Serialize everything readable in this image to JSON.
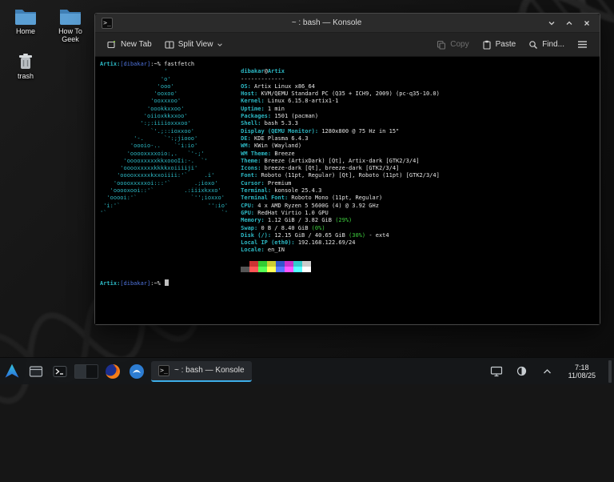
{
  "desktop": {
    "icons": [
      {
        "label": "Home",
        "type": "folder"
      },
      {
        "label": "How To Geek",
        "type": "folder"
      },
      {
        "label": "trash",
        "type": "trash"
      }
    ]
  },
  "window": {
    "title": "~ : bash — Konsole",
    "toolbar": {
      "new_tab": "New Tab",
      "split_view": "Split View",
      "copy": "Copy",
      "paste": "Paste",
      "find": "Find..."
    }
  },
  "terminal": {
    "prompt_command": [
      {
        "t": "Artix:",
        "c": "cyan"
      },
      {
        "t": "[dibakar]",
        "c": "blue"
      },
      {
        "t": ":~%",
        "c": "fg"
      },
      {
        "t": " fastfetch",
        "c": "fg"
      }
    ],
    "prompt": [
      {
        "t": "Artix:",
        "c": "cyan"
      },
      {
        "t": "[dibakar]",
        "c": "blue"
      },
      {
        "t": ":~%",
        "c": "fg"
      },
      {
        "t": " ",
        "c": "fg"
      }
    ],
    "art": [
      "                   '",
      "                  'o'",
      "                 'ooo'",
      "                'ooxoo'",
      "               'ooxxxoo'",
      "              'oookkxxoo'",
      "             'oiioxkkxxoo'",
      "            ':;:iiiioxxxoo'",
      "               `'.;::ioxxoo'",
      "          '-.      `':;jiooo'",
      "         'oooio-..    `'i:io'",
      "        'ooooxxxxoio:,.   `'-;'",
      "       'ooooxxxxxkkxoooIi:-.  `'",
      "      'ooooxxxxxkkkkxoiiiiji'",
      "     'ooooxxxxxkxxoiiii:'`     .i'",
      "    'ooooxxxxxoi:::'`       .;ioxo'",
      "   'ooooxooi::'`         .:iiixkxxo'",
      "  'ooooi:'`                `'';ioxxo'",
      " 'i:'`                          '':io'",
      "'`                                  `'"
    ],
    "info": [
      {
        "segments": [
          {
            "t": "dibakar",
            "c": "cyan"
          },
          {
            "t": "@",
            "c": "fg"
          },
          {
            "t": "Artix",
            "c": "cyan"
          }
        ]
      },
      {
        "segments": [
          {
            "t": "-------------",
            "c": "fg"
          }
        ]
      },
      {
        "label": "OS:",
        "segments": [
          {
            "t": "Artix Linux x86_64"
          }
        ]
      },
      {
        "label": "Host:",
        "segments": [
          {
            "t": "KVM/QEMU Standard PC (Q35 + ICH9, 2009) (pc-q35-10.0)"
          }
        ]
      },
      {
        "label": "Kernel:",
        "segments": [
          {
            "t": "Linux 6.15.8-artix1-1"
          }
        ]
      },
      {
        "label": "Uptime:",
        "segments": [
          {
            "t": "1 min"
          }
        ]
      },
      {
        "label": "Packages:",
        "segments": [
          {
            "t": "1501 (pacman)"
          }
        ]
      },
      {
        "label": "Shell:",
        "segments": [
          {
            "t": "bash 5.3.3"
          }
        ]
      },
      {
        "label": "Display (QEMU Monitor):",
        "segments": [
          {
            "t": "1280x800 @ 75 Hz in 15\""
          }
        ]
      },
      {
        "label": "DE:",
        "segments": [
          {
            "t": "KDE Plasma 6.4.3"
          }
        ]
      },
      {
        "label": "WM:",
        "segments": [
          {
            "t": "KWin (Wayland)"
          }
        ]
      },
      {
        "label": "WM Theme:",
        "segments": [
          {
            "t": "Breeze"
          }
        ]
      },
      {
        "label": "Theme:",
        "segments": [
          {
            "t": "Breeze (ArtixDark) [Qt], Artix-dark [GTK2/3/4]"
          }
        ]
      },
      {
        "label": "Icons:",
        "segments": [
          {
            "t": "breeze-dark [Qt], breeze-dark [GTK2/3/4]"
          }
        ]
      },
      {
        "label": "Font:",
        "segments": [
          {
            "t": "Roboto (11pt, Regular) [Qt], Roboto (11pt) [GTK2/3/4]"
          }
        ]
      },
      {
        "label": "Cursor:",
        "segments": [
          {
            "t": "Premium"
          }
        ]
      },
      {
        "label": "Terminal:",
        "segments": [
          {
            "t": "konsole 25.4.3"
          }
        ]
      },
      {
        "label": "Terminal Font:",
        "segments": [
          {
            "t": "Roboto Mono (11pt, Regular)"
          }
        ]
      },
      {
        "label": "CPU:",
        "segments": [
          {
            "t": "4 x AMD Ryzen 5 5600G (4) @ 3.92 GHz"
          }
        ]
      },
      {
        "label": "GPU:",
        "segments": [
          {
            "t": "RedHat Virtio 1.0 GPU"
          }
        ]
      },
      {
        "label": "Memory:",
        "segments": [
          {
            "t": "1.12 GiB / 3.82 GiB "
          },
          {
            "t": "(29%)",
            "c": "green"
          }
        ]
      },
      {
        "label": "Swap:",
        "segments": [
          {
            "t": "0 B / 8.40 GiB "
          },
          {
            "t": "(0%)",
            "c": "green"
          }
        ]
      },
      {
        "label": "Disk (/):",
        "segments": [
          {
            "t": "12.15 GiB / 40.65 GiB "
          },
          {
            "t": "(30%)",
            "c": "green"
          },
          {
            "t": " - ext4"
          }
        ]
      },
      {
        "label": "Local IP (eth0):",
        "segments": [
          {
            "t": "192.168.122.69/24"
          }
        ]
      },
      {
        "label": "Locale:",
        "segments": [
          {
            "t": "en_IN"
          }
        ]
      }
    ],
    "palette": [
      [
        "#000000",
        "#cc3333",
        "#33cc33",
        "#cccc33",
        "#3355cc",
        "#cc33cc",
        "#33cccc",
        "#cccccc"
      ],
      [
        "#555555",
        "#ff5555",
        "#55ff55",
        "#ffff55",
        "#5577ff",
        "#ff55ff",
        "#55ffff",
        "#ffffff"
      ]
    ]
  },
  "taskbar": {
    "task_label": "~ : bash — Konsole",
    "clock_time": "7:18",
    "clock_date": "11/08/25"
  },
  "colors": {
    "accent": "#3daee9",
    "terminal_cyan": "#2cb8c4",
    "terminal_blue": "#4f74dd",
    "terminal_green": "#3ecf3e"
  }
}
